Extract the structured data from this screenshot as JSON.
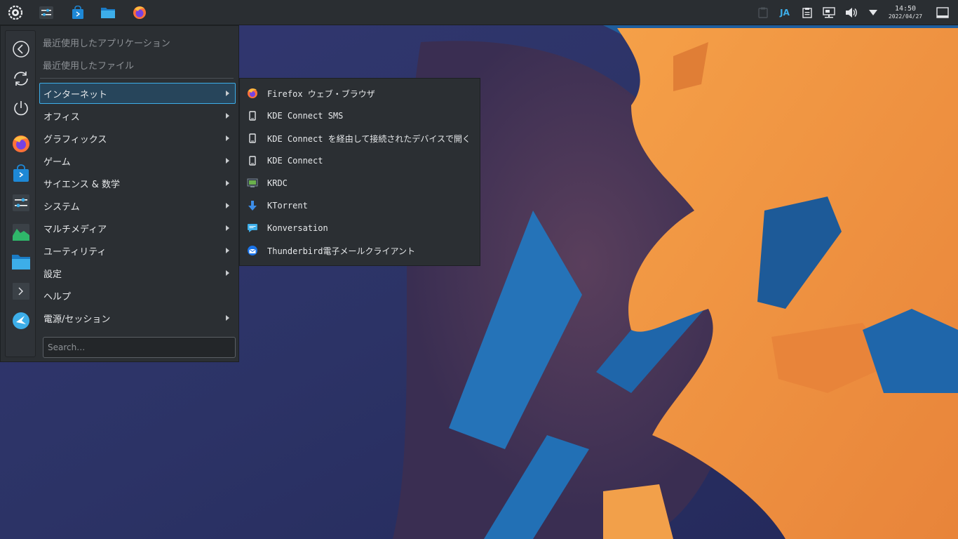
{
  "panel": {
    "tray_language": "JA",
    "clock_time": "14:50",
    "clock_date": "2022/04/27"
  },
  "menu": {
    "recent_apps": "最近使用したアプリケーション",
    "recent_files": "最近使用したファイル",
    "categories": [
      {
        "label": "インターネット",
        "has_submenu": true,
        "active": true
      },
      {
        "label": "オフィス",
        "has_submenu": true
      },
      {
        "label": "グラフィックス",
        "has_submenu": true
      },
      {
        "label": "ゲーム",
        "has_submenu": true
      },
      {
        "label": "サイエンス & 数学",
        "has_submenu": true
      },
      {
        "label": "システム",
        "has_submenu": true
      },
      {
        "label": "マルチメディア",
        "has_submenu": true
      },
      {
        "label": "ユーティリティ",
        "has_submenu": true
      },
      {
        "label": "設定",
        "has_submenu": true
      },
      {
        "label": "ヘルプ",
        "has_submenu": false
      },
      {
        "label": "電源/セッション",
        "has_submenu": true
      }
    ],
    "search_placeholder": "Search…"
  },
  "submenu": {
    "items": [
      {
        "label": "Firefox ウェブ・ブラウザ",
        "icon": "firefox-icon"
      },
      {
        "label": "KDE Connect SMS",
        "icon": "phone-icon"
      },
      {
        "label": "KDE Connect を経由して接続されたデバイスで開く",
        "icon": "phone-icon"
      },
      {
        "label": "KDE Connect",
        "icon": "phone-icon"
      },
      {
        "label": "KRDC",
        "icon": "remote-desktop-icon"
      },
      {
        "label": "KTorrent",
        "icon": "download-icon"
      },
      {
        "label": "Konversation",
        "icon": "chat-icon"
      },
      {
        "label": "Thunderbird電子メールクライアント",
        "icon": "thunderbird-icon"
      }
    ]
  },
  "colors": {
    "accent": "#3daee9",
    "panel_bg": "#2a2e32",
    "wallpaper_orange": "#f0923a",
    "wallpaper_blue": "#1f5d9c"
  }
}
